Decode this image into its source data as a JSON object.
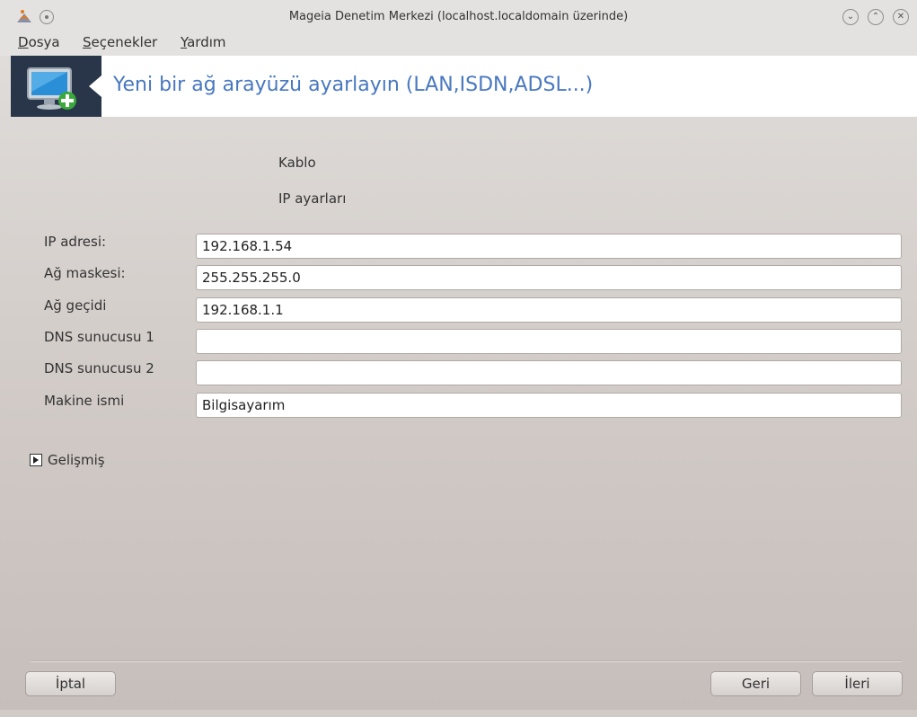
{
  "window": {
    "title": "Mageia Denetim Merkezi  (localhost.localdomain üzerinde)"
  },
  "menubar": {
    "items": [
      {
        "label": "Dosya",
        "mnemonic": "D",
        "rest": "osya"
      },
      {
        "label": "Seçenekler",
        "mnemonic": "S",
        "rest": "eçenekler"
      },
      {
        "label": "Yardım",
        "mnemonic": "Y",
        "rest": "ardım"
      }
    ]
  },
  "banner": {
    "title": "Yeni bir ağ arayüzü ayarlayın (LAN,ISDN,ADSL...)",
    "icon": "network-monitor-add-icon"
  },
  "form": {
    "section_cable": "Kablo",
    "section_ip": "IP ayarları",
    "fields": [
      {
        "label": "IP adresi:",
        "value": "192.168.1.54"
      },
      {
        "label": "Ağ maskesi:",
        "value": "255.255.255.0"
      },
      {
        "label": "Ağ geçidi",
        "value": "192.168.1.1"
      },
      {
        "label": "DNS sunucusu 1",
        "value": ""
      },
      {
        "label": "DNS sunucusu 2",
        "value": ""
      },
      {
        "label": "Makine ismi",
        "value": "Bilgisayarım"
      }
    ],
    "advanced_label": "Gelişmiş"
  },
  "buttons": {
    "cancel": "İptal",
    "back": "Geri",
    "next": "İleri"
  },
  "colors": {
    "banner_title": "#4878c0",
    "banner_icon_bg": "#29364a"
  }
}
